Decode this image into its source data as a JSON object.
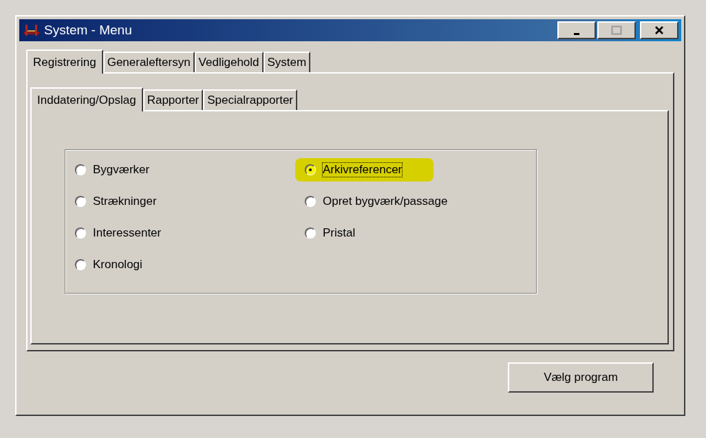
{
  "window": {
    "title": "System - Menu"
  },
  "tabs": [
    {
      "label": "Registrering",
      "selected": true
    },
    {
      "label": "Generaleftersyn",
      "selected": false
    },
    {
      "label": "Vedligehold",
      "selected": false
    },
    {
      "label": "System",
      "selected": false
    }
  ],
  "subtabs": [
    {
      "label": "Inddatering/Opslag",
      "selected": true
    },
    {
      "label": "Rapporter",
      "selected": false
    },
    {
      "label": "Specialrapporter",
      "selected": false
    }
  ],
  "options": [
    {
      "label": "Bygværker",
      "selected": false,
      "highlighted": false
    },
    {
      "label": "Strækninger",
      "selected": false,
      "highlighted": false
    },
    {
      "label": "Interessenter",
      "selected": false,
      "highlighted": false
    },
    {
      "label": "Kronologi",
      "selected": false,
      "highlighted": false
    },
    {
      "label": "Arkivreferencer",
      "selected": true,
      "highlighted": true
    },
    {
      "label": "Opret bygværk/passage",
      "selected": false,
      "highlighted": false
    },
    {
      "label": "Pristal",
      "selected": false,
      "highlighted": false
    }
  ],
  "buttons": [
    {
      "label": "Vælg program"
    }
  ]
}
